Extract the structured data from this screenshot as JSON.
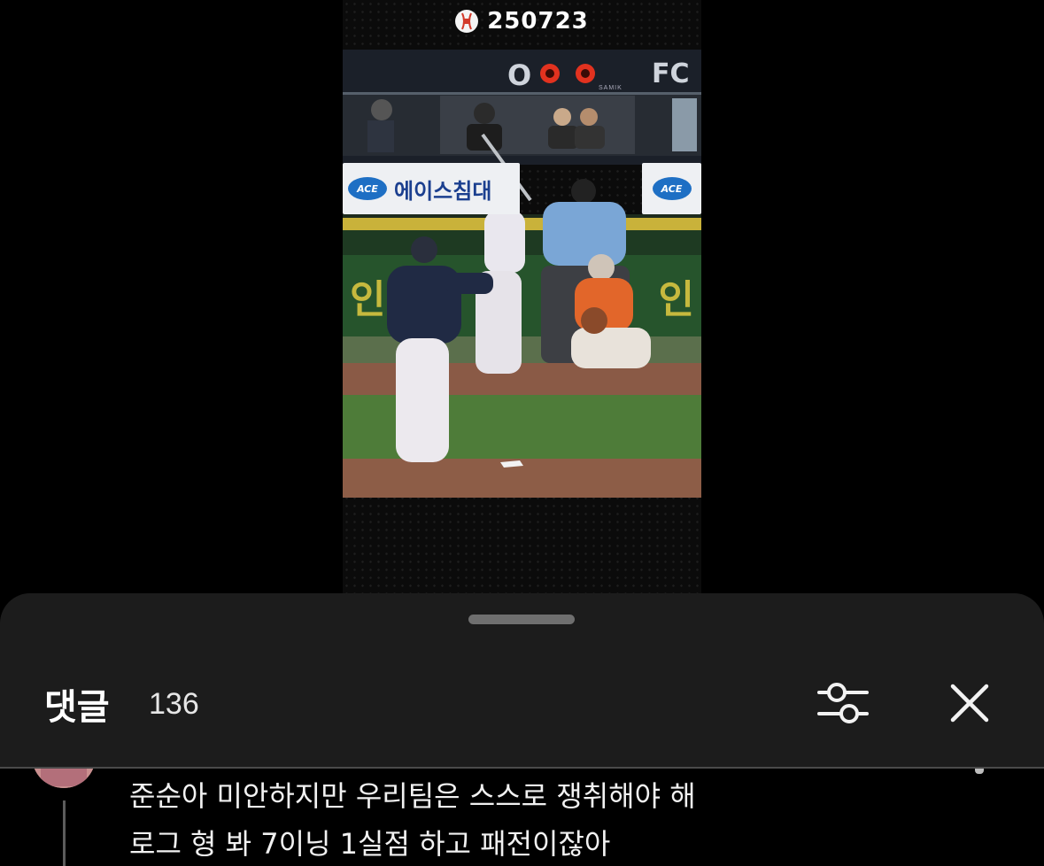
{
  "video": {
    "title": "250723",
    "scoreboard": {
      "left": "O",
      "right": "FC",
      "brand": "SAMIK"
    },
    "signs": {
      "left_text": "에이스침대",
      "logo": "ACE"
    },
    "banner_left": "인",
    "banner_right": "인"
  },
  "comments": {
    "title": "댓글",
    "count": "136",
    "items": [
      {
        "lines": [
          "준순아 미안하지만 우리팀은 스스로 쟁취해야 해",
          "로그 형 봐 7이닝 1실점 하고 패전이잖아"
        ]
      }
    ]
  },
  "colors": {
    "sheet_bg": "#1c1c1c",
    "scoreboard_lights": "#e2321f",
    "sign_text": "#1b3f8f"
  },
  "icons": [
    "baseball-icon",
    "filter-icon",
    "close-icon"
  ]
}
